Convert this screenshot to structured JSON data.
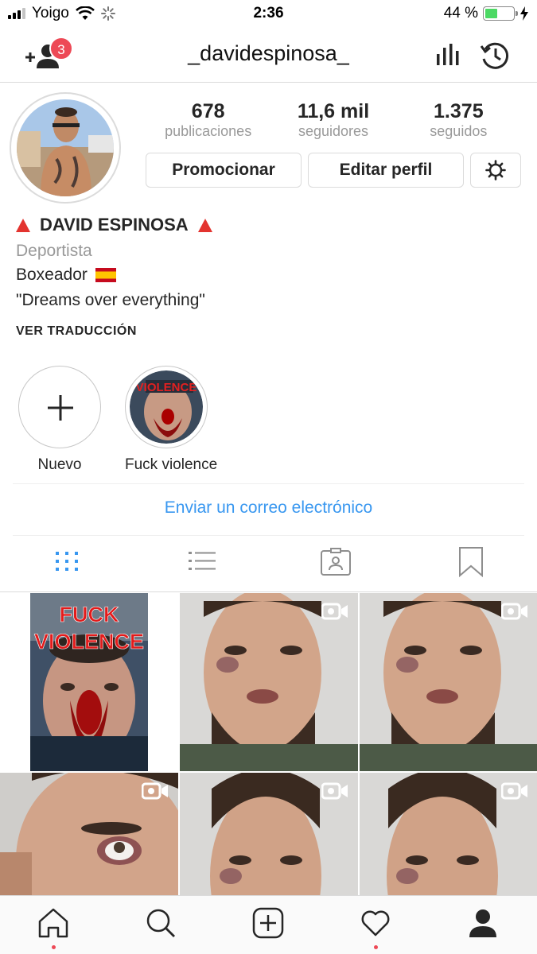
{
  "status_bar": {
    "carrier": "Yoigo",
    "time": "2:36",
    "battery_percent": "44 %",
    "battery_level": 0.44
  },
  "header": {
    "username": "_davidespinosa_",
    "notification_count": "3",
    "icons": [
      "add-user-icon",
      "insights-icon",
      "archive-icon"
    ]
  },
  "profile": {
    "stats": [
      {
        "value": "678",
        "label": "publicaciones"
      },
      {
        "value": "11,6 mil",
        "label": "seguidores"
      },
      {
        "value": "1.375",
        "label": "seguidos"
      }
    ],
    "promote_label": "Promocionar",
    "edit_label": "Editar perfil"
  },
  "bio": {
    "name": "DAVID ESPINOSA",
    "category": "Deportista",
    "line1": "Boxeador",
    "line2": "\"Dreams over everything\"",
    "translate_label": "VER TRADUCCIÓN"
  },
  "highlights": [
    {
      "label": "Nuevo"
    },
    {
      "label": "Fuck violence",
      "overlay_text": "VIOLENCE"
    }
  ],
  "email_label": "Enviar un correo electrónico",
  "grid": {
    "first_post_text": [
      "FUCK",
      "VIOLENCE"
    ]
  },
  "colors": {
    "accent": "#3897f0",
    "badge": "#ed4956",
    "text": "#262626",
    "muted": "#999999"
  }
}
